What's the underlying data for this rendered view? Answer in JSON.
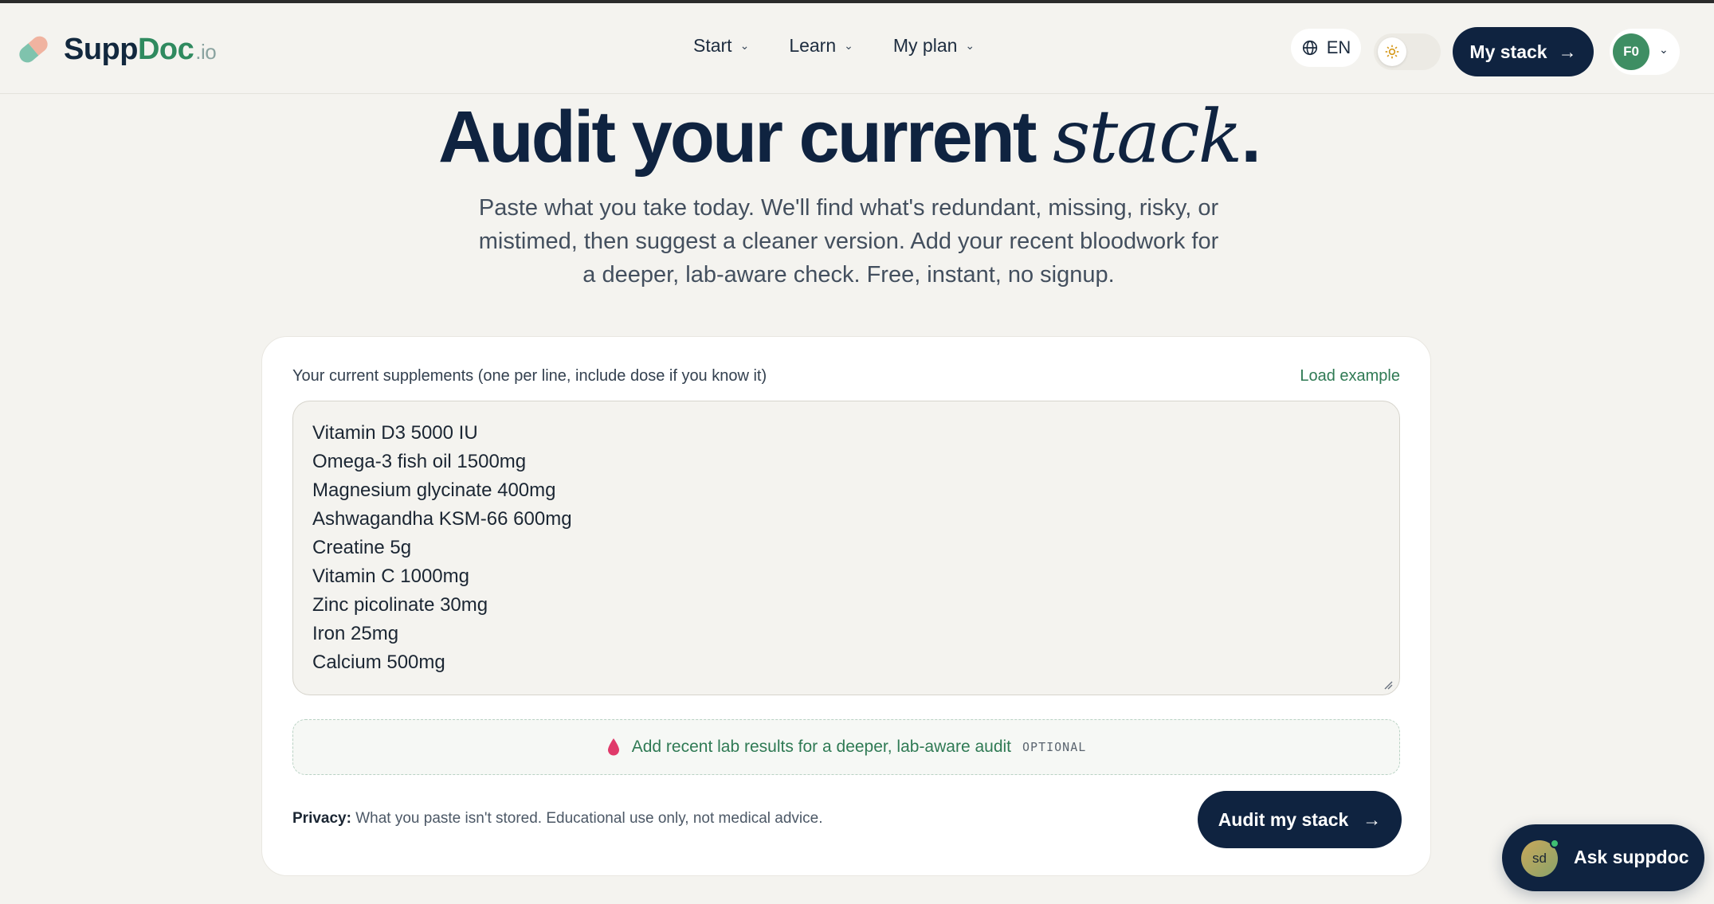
{
  "brand": {
    "name_a": "Supp",
    "name_b": "Doc",
    "suffix": ".io",
    "accent": "#2f8a5f",
    "navy": "#0f2340"
  },
  "nav": [
    {
      "label": "Start"
    },
    {
      "label": "Learn"
    },
    {
      "label": "My plan"
    }
  ],
  "header": {
    "language": "EN",
    "theme_icon": "sun-icon",
    "my_stack_label": "My stack",
    "avatar_initials": "F0"
  },
  "hero": {
    "title_main": "Audit your current",
    "title_italic": "stack",
    "title_end": ".",
    "subtitle": "Paste what you take today. We'll find what's redundant, missing, risky, or mistimed, then suggest a cleaner version. Add your recent bloodwork for a deeper, lab-aware check. Free, instant, no signup."
  },
  "form": {
    "label": "Your current supplements (one per line, include dose if you know it)",
    "load_example": "Load example",
    "supplements": [
      "Vitamin D3 5000 IU",
      "Omega-3 fish oil 1500mg",
      "Magnesium glycinate 400mg",
      "Ashwagandha KSM-66 600mg",
      "Creatine 5g",
      "Vitamin C 1000mg",
      "Zinc picolinate 30mg",
      "Iron 25mg",
      "Calcium 500mg"
    ],
    "labs_text": "Add recent lab results for a deeper, lab-aware audit",
    "labs_optional": "OPTIONAL",
    "privacy_label": "Privacy:",
    "privacy_text": "What you paste isn't stored. Educational use only, not medical advice.",
    "submit_label": "Audit my stack"
  },
  "chat": {
    "avatar_text": "sd",
    "label": "Ask suppdoc"
  }
}
